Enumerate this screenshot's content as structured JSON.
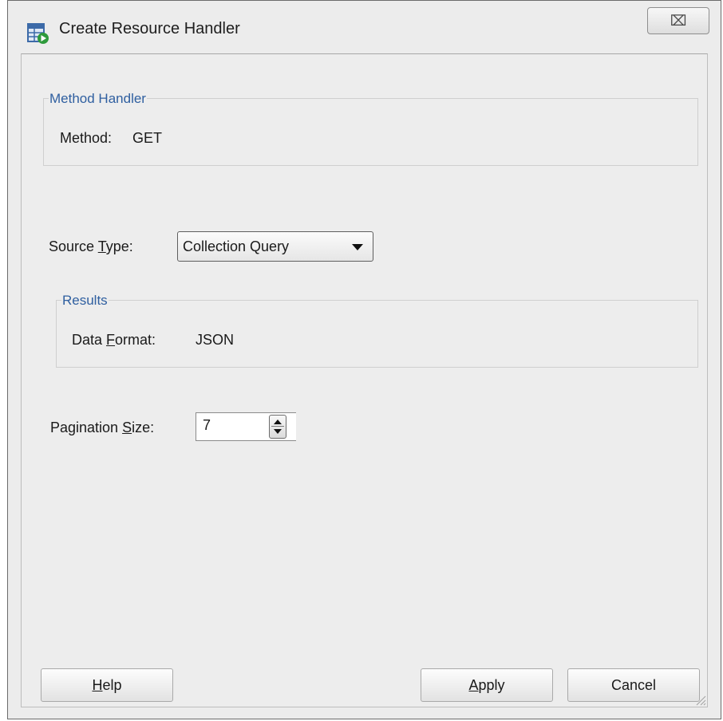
{
  "window": {
    "title": "Create Resource Handler",
    "close_glyph": "⌧"
  },
  "method_handler": {
    "legend": "Method Handler",
    "method_label": "Method:",
    "method_value": "GET"
  },
  "source_type": {
    "label_pre": "Source ",
    "label_mnemonic": "T",
    "label_post": "ype:",
    "value": "Collection Query"
  },
  "results": {
    "legend": "Results",
    "format_label_pre": "Data ",
    "format_label_mnemonic": "F",
    "format_label_post": "ormat:",
    "format_value": "JSON"
  },
  "pagination": {
    "label_pre": "Pagination ",
    "label_mnemonic": "S",
    "label_post": "ize:",
    "value": "7"
  },
  "buttons": {
    "help": {
      "mnemonic": "H",
      "rest": "elp"
    },
    "apply": {
      "mnemonic": "A",
      "rest": "pply"
    },
    "cancel": "Cancel"
  },
  "colors": {
    "legend": "#2f5fa0",
    "background": "#ececec"
  },
  "icons": {
    "title": "table-run-icon",
    "close": "close-icon",
    "resize": "resize-grip-icon"
  }
}
